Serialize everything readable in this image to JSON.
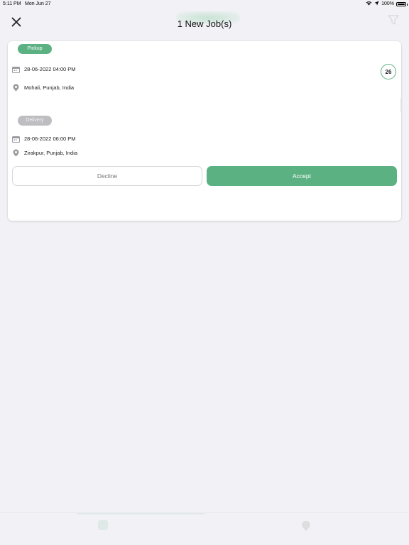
{
  "status_bar": {
    "time": "5:11 PM",
    "date": "Mon Jun 27",
    "battery": "100%"
  },
  "header": {
    "title": "1 New Job(s)"
  },
  "job": {
    "pickup": {
      "tag": "Pickup",
      "datetime": "28-06-2022 04:00 PM",
      "location": "Mohali, Punjab, India"
    },
    "delivery": {
      "tag": "Delivery",
      "datetime": "28-06-2022 06:00 PM",
      "location": "Zirakpur, Punjab, India"
    },
    "countdown": "26",
    "decline_label": "Decline",
    "accept_label": "Accept"
  },
  "colors": {
    "accent": "#5cb183",
    "tag_inactive": "#bdbdc2",
    "background": "#f2f2f6"
  },
  "icons": [
    "close-icon",
    "wifi-icon",
    "location-arrow-icon",
    "battery-icon",
    "calendar-icon",
    "location-pin-icon",
    "filter-icon"
  ]
}
